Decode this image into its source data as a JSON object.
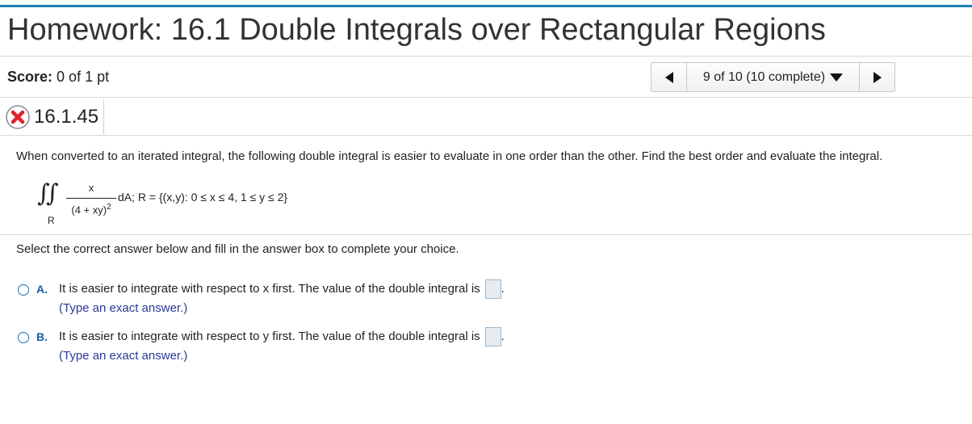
{
  "page": {
    "title": "Homework: 16.1 Double Integrals over Rectangular Regions"
  },
  "score": {
    "label": "Score:",
    "value": "0 of 1 pt"
  },
  "nav": {
    "progress": "9 of 10 (10 complete)"
  },
  "question": {
    "id": "16.1.45",
    "status": "incorrect",
    "prompt": "When converted to an iterated integral, the following double integral is easier to evaluate in one order than the other. Find the best order and evaluate the integral.",
    "integral": {
      "numerator": "x",
      "denominator": "(4 + xy)",
      "exponent": "2",
      "region_label": "R",
      "rest": "dA; R = {(x,y): 0 ≤ x ≤ 4, 1 ≤ y ≤ 2}"
    },
    "instruction": "Select the correct answer below and fill in the answer box to complete your choice.",
    "choices": [
      {
        "letter": "A.",
        "text": "It is easier to integrate with respect to x first. The value of the double integral is",
        "suffix": ".",
        "hint": "(Type an exact answer.)"
      },
      {
        "letter": "B.",
        "text": "It is easier to integrate with respect to y first. The value of the double integral is",
        "suffix": ".",
        "hint": "(Type an exact answer.)"
      }
    ]
  },
  "colors": {
    "accent_bar": "#1a7fb5",
    "incorrect_icon": "#e0222a",
    "choice_letter": "#1a5fa8",
    "hint_text": "#2a3a9a"
  },
  "icons": [
    "incorrect-x-icon",
    "prev-arrow-icon",
    "next-arrow-icon",
    "dropdown-caret-icon"
  ]
}
